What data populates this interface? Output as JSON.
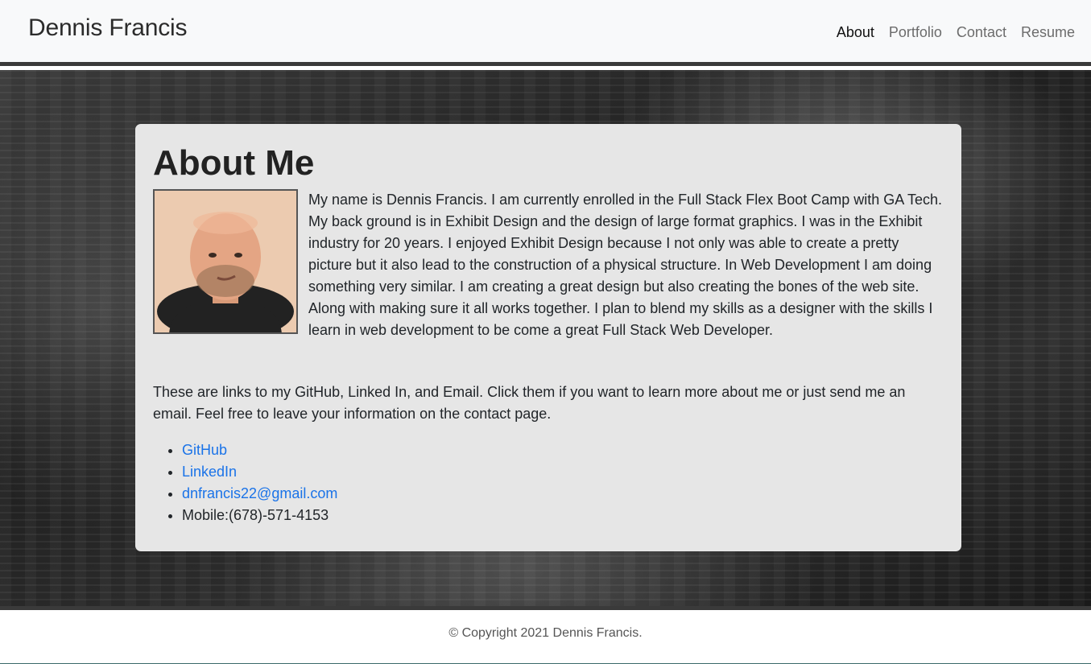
{
  "navbar": {
    "brand": "Dennis Francis",
    "links": [
      {
        "label": "About"
      },
      {
        "label": "Portfolio"
      },
      {
        "label": "Contact"
      },
      {
        "label": "Resume"
      }
    ]
  },
  "about": {
    "title": "About Me",
    "bio": "My name is Dennis Francis. I am currently enrolled in the Full Stack Flex Boot Camp with GA Tech. My back ground is in Exhibit Design and the design of large format graphics. I was in the Exhibit industry for 20 years. I enjoyed Exhibit Design because I not only was able to create a pretty picture but it also lead to the construction of a physical structure. In Web Development I am doing something very similar. I am creating a great design but also creating the bones of the web site. Along with making sure it all works together. I plan to blend my skills as a designer with the skills I learn in web development to be come a great Full Stack Web Developer.",
    "links_intro": "These are links to my GitHub, Linked In, and Email. Click them if you want to learn more about me or just send me an email. Feel free to leave your information on the contact page.",
    "links": [
      {
        "label": "GitHub"
      },
      {
        "label": "LinkedIn"
      },
      {
        "label": "dnfrancis22@gmail.com"
      }
    ],
    "mobile": "Mobile:(678)-571-4153"
  },
  "footer": {
    "copyright": "© Copyright 2021 Dennis Francis."
  },
  "colors": {
    "link": "#1a73e8",
    "card_bg": "#e6e6e6",
    "navbar_bg": "#f8f9fa"
  }
}
